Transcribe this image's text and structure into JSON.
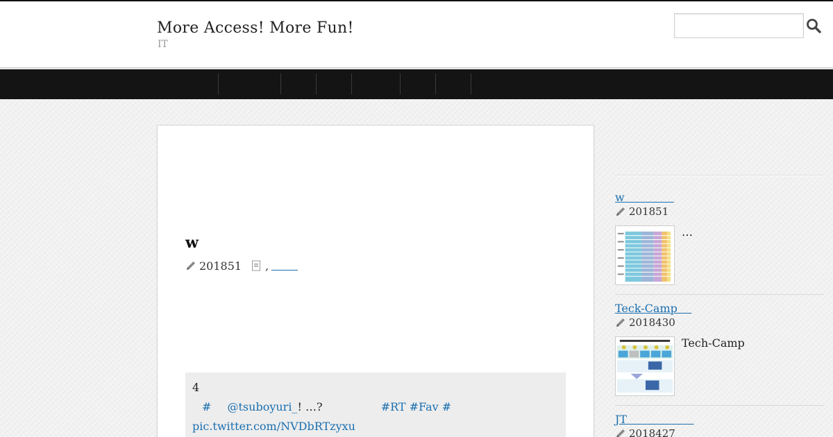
{
  "header": {
    "site_title": "More Access! More Fun!",
    "site_description": "IT",
    "search": {
      "placeholder": "",
      "value": ""
    }
  },
  "nav": {
    "items": [
      "",
      "",
      "",
      "",
      "",
      "",
      ""
    ]
  },
  "post": {
    "title": "w",
    "date": "201851",
    "category_separator": ",",
    "quote": {
      "number": "4",
      "hashtag1": "#",
      "mention": "@tsuboyuri_",
      "mention_suffix": "! …?",
      "hashtag_rt": "#RT",
      "hashtag_fav": "#Fav",
      "hashtag3": "#",
      "pic_link": "pic.twitter.com/NVDbRTzyxu"
    }
  },
  "sidebar": {
    "entries": [
      {
        "title": "w              ",
        "date": "201851",
        "excerpt": "…"
      },
      {
        "title": "Teck-Camp    ",
        "date": "2018430",
        "excerpt": "Tech-Camp"
      },
      {
        "title": "JT                   ",
        "date": "2018427",
        "excerpt": ""
      }
    ]
  },
  "colors": {
    "link": "#1a6fb0",
    "navbar": "#141414",
    "quote_bg": "#ededed"
  }
}
